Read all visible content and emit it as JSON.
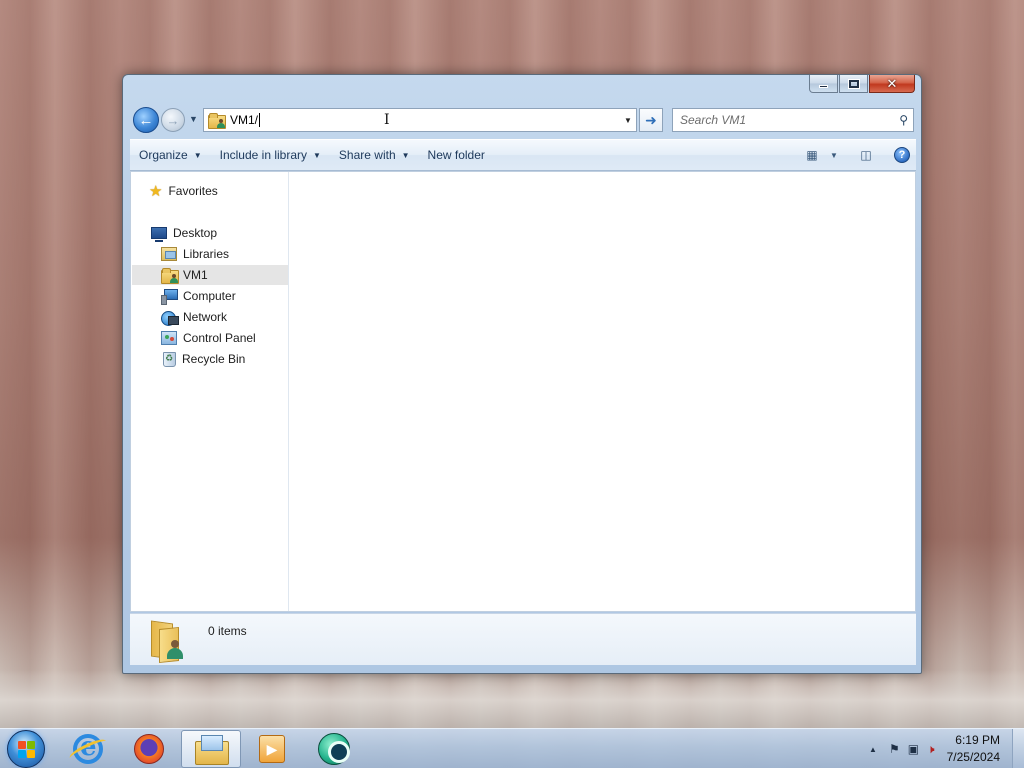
{
  "window": {
    "address_path": "VM1/",
    "search_placeholder": "Search VM1",
    "caption": {
      "minimize_icon": "minimize-icon",
      "maximize_icon": "maximize-icon",
      "close_icon": "close-icon"
    }
  },
  "toolbar": {
    "organize": "Organize",
    "include_in_library": "Include in library",
    "share_with": "Share with",
    "new_folder": "New folder"
  },
  "navpane": {
    "favorites": "Favorites",
    "desktop": "Desktop",
    "libraries": "Libraries",
    "vm1": "VM1",
    "computer": "Computer",
    "network": "Network",
    "control_panel": "Control Panel",
    "recycle_bin": "Recycle Bin",
    "selected": "VM1"
  },
  "details": {
    "item_count": "0 items"
  },
  "taskbar": {
    "pinned": [
      "internet-explorer-icon",
      "firefox-icon",
      "windows-explorer-icon",
      "media-player-icon",
      "teal-app-icon"
    ],
    "active": "windows-explorer-icon",
    "clock_time": "6:19 PM",
    "clock_date": "7/25/2024"
  },
  "colors": {
    "selection": "#e5e5e5",
    "window_frame": "#b9cfe7",
    "link_text": "#1e395b"
  }
}
